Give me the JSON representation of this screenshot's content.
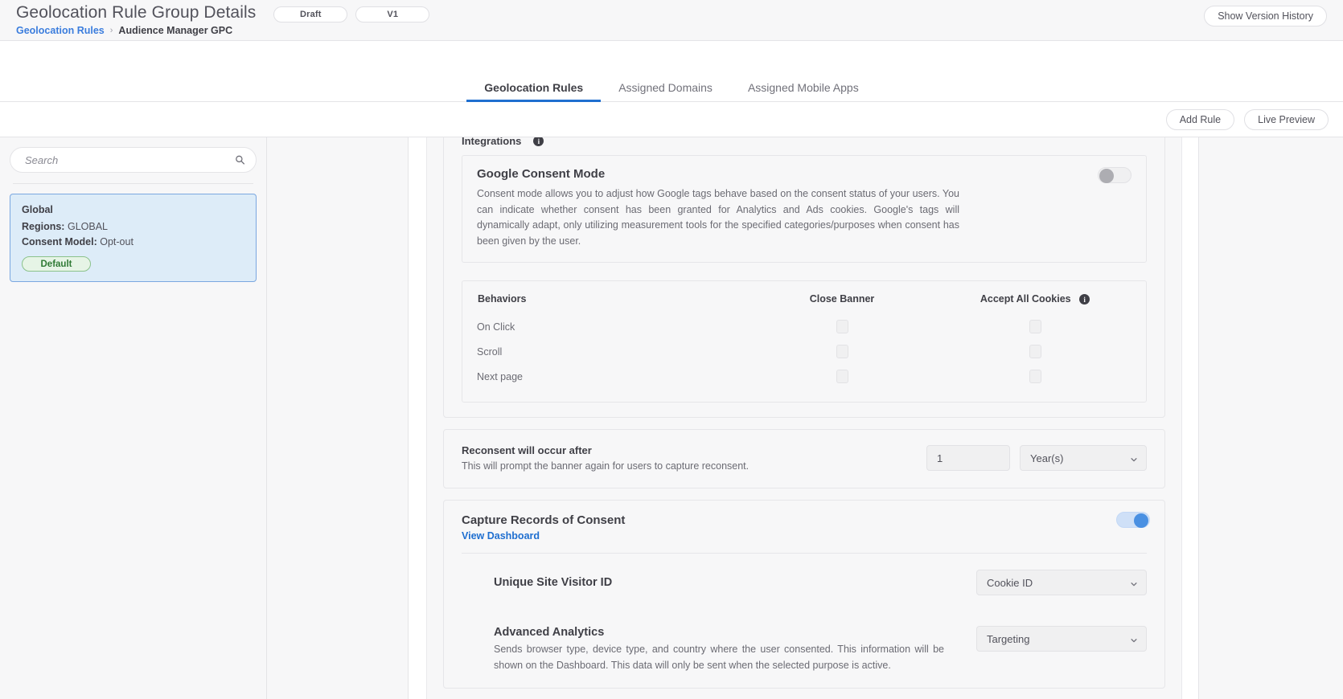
{
  "header": {
    "title": "Geolocation Rule Group Details",
    "breadcrumb": {
      "parent": "Geolocation Rules",
      "separator": "›",
      "current": "Audience Manager GPC"
    },
    "pills": [
      {
        "label": "Draft"
      },
      {
        "label": "V1"
      }
    ],
    "version_history_button": "Show Version History"
  },
  "tabs": [
    {
      "label": "Geolocation Rules",
      "active": true
    },
    {
      "label": "Assigned Domains",
      "active": false
    },
    {
      "label": "Assigned Mobile Apps",
      "active": false
    }
  ],
  "action_bar": {
    "add_rule": "Add Rule",
    "live_preview": "Live Preview"
  },
  "sidebar": {
    "search": {
      "placeholder": "Search",
      "value": "",
      "icon": "search-icon"
    },
    "rule_card": {
      "name": "Global",
      "regions_label": "Regions:",
      "regions_value": "GLOBAL",
      "consent_model_label": "Consent Model:",
      "consent_model_value": "Opt-out",
      "badge": "Default"
    }
  },
  "main": {
    "integrations": {
      "label": "Integrations",
      "info_icon": "info-icon"
    },
    "google_consent_mode": {
      "title": "Google Consent Mode",
      "description": "Consent mode allows you to adjust how Google tags behave based on the consent status of your users. You can indicate whether consent has been granted for Analytics and Ads cookies. Google's tags will dynamically adapt, only utilizing measurement tools for the specified categories/purposes when consent has been given by the user.",
      "toggle_state": "off"
    },
    "behaviors": {
      "header_behaviors": "Behaviors",
      "header_close_banner": "Close Banner",
      "header_accept_all": "Accept All Cookies",
      "info_icon": "info-icon",
      "rows": [
        {
          "label": "On Click",
          "close_banner": false,
          "accept_all": false
        },
        {
          "label": "Scroll",
          "close_banner": false,
          "accept_all": false
        },
        {
          "label": "Next page",
          "close_banner": false,
          "accept_all": false
        }
      ]
    },
    "reconsent": {
      "title": "Reconsent will occur after",
      "description": "This will prompt the banner again for users to capture reconsent.",
      "amount_value": "1",
      "amount_placeholder": "1",
      "unit_value": "Year(s)"
    },
    "capture_records": {
      "title": "Capture Records of Consent",
      "link": "View Dashboard",
      "toggle_state": "on",
      "rows": [
        {
          "title": "Unique Site Visitor ID",
          "description": "",
          "select_value": "Cookie ID"
        },
        {
          "title": "Advanced Analytics",
          "description": "Sends browser type, device type, and country where the user consented. This information will be shown on the Dashboard. This data will only be sent when the selected purpose is active.",
          "select_value": "Targeting"
        }
      ]
    }
  },
  "colors": {
    "accent_blue": "#1f6fd0",
    "link_blue": "#3b7ddd",
    "toggle_on": "#4a90e2",
    "badge_green": "#2f7a35",
    "card_selected_bg": "#ddecf8",
    "panel_bg": "#f7f7f8"
  }
}
